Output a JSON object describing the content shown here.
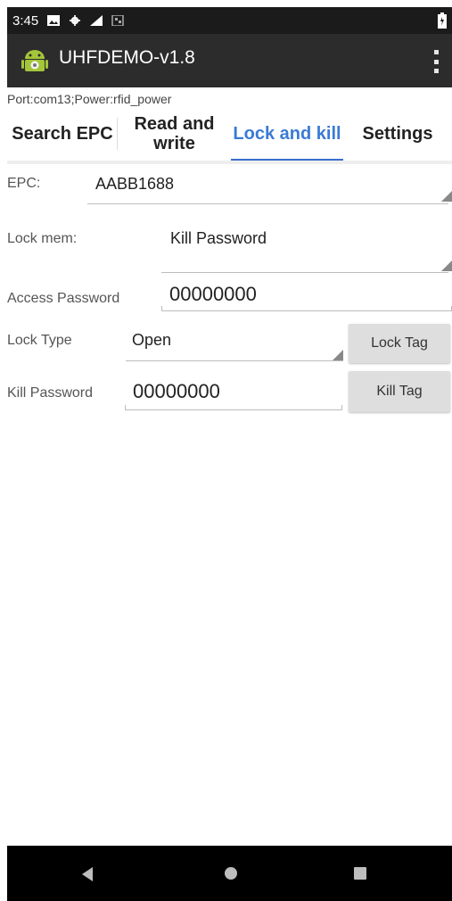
{
  "status_bar": {
    "time": "3:45"
  },
  "app_bar": {
    "title": "UHFDEMO-v1.8"
  },
  "port_info": "Port:com13;Power:rfid_power",
  "tabs": [
    {
      "label": "Search EPC",
      "active": false
    },
    {
      "label": "Read and\nwrite",
      "active": false
    },
    {
      "label": "Lock and kill",
      "active": true
    },
    {
      "label": "Settings",
      "active": false
    }
  ],
  "form": {
    "epc": {
      "label": "EPC:",
      "value": "AABB1688"
    },
    "lock_mem": {
      "label": "Lock mem:",
      "value": "Kill Password"
    },
    "access_password": {
      "label": "Access Password",
      "value": "00000000"
    },
    "lock_type": {
      "label": "Lock Type",
      "value": "Open",
      "button": "Lock Tag"
    },
    "kill_password": {
      "label": "Kill Password",
      "value": "00000000",
      "button": "Kill Tag"
    }
  },
  "colors": {
    "accent": "#3a6fd0",
    "app_bar": "#2c2c2c",
    "status_bar": "#1b1b1b"
  }
}
